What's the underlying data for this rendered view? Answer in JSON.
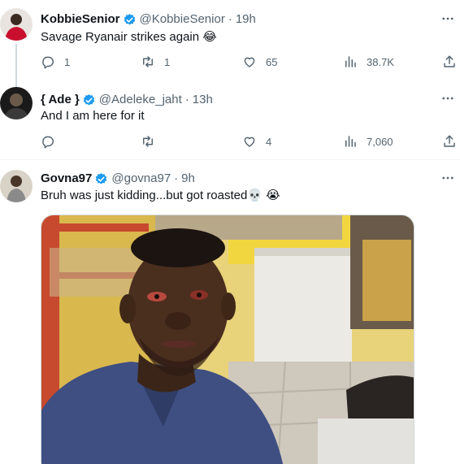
{
  "tweets": [
    {
      "name": "KobbieSenior",
      "handle": "@KobbieSenior",
      "time": "19h",
      "text": "Savage Ryanair strikes again 😂",
      "replies": "1",
      "retweets": "1",
      "likes": "65",
      "views": "38.7K"
    },
    {
      "name": "{ Ade }",
      "handle": "@Adeleke_jaht",
      "time": "13h",
      "text": "And I am here for it",
      "replies": "",
      "retweets": "",
      "likes": "4",
      "views": "7,060"
    },
    {
      "name": "Govna97",
      "handle": "@govna97",
      "time": "9h",
      "text": "Bruh was just kidding...but got roasted💀 😭"
    }
  ],
  "colors": {
    "verified": "#1d9bf0",
    "secondary_text": "#536471",
    "divider": "#eff3f4"
  },
  "icons": [
    "more-icon",
    "reply-icon",
    "retweet-icon",
    "like-icon",
    "views-icon",
    "share-icon",
    "verified-badge-icon"
  ]
}
